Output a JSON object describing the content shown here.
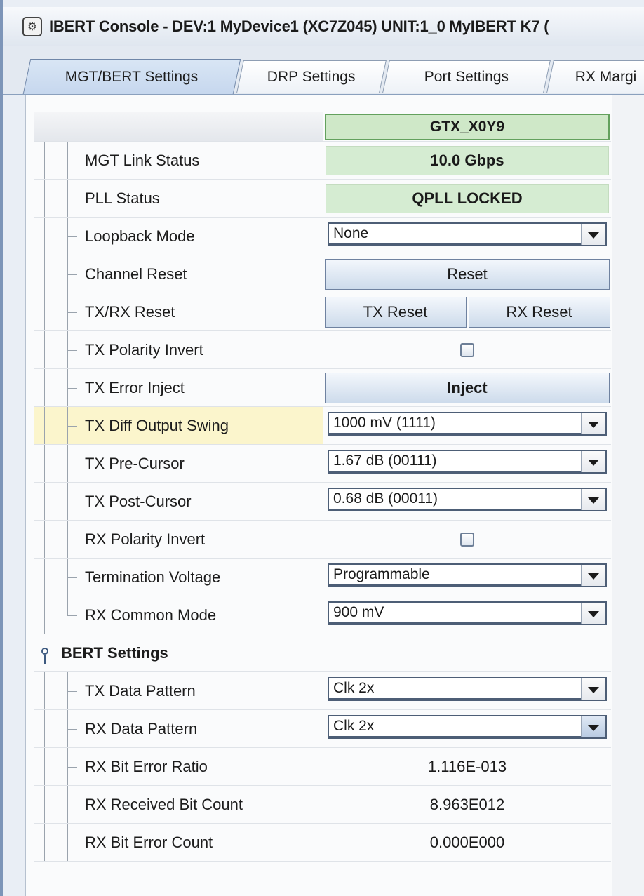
{
  "window": {
    "title": "IBERT Console - DEV:1 MyDevice1 (XC7Z045) UNIT:1_0 MyIBERT K7 (",
    "icon": "ibert-app-icon"
  },
  "tabs": [
    {
      "label": "MGT/BERT Settings",
      "active": true
    },
    {
      "label": "DRP Settings",
      "active": false
    },
    {
      "label": "Port Settings",
      "active": false
    },
    {
      "label": "RX Margi",
      "active": false
    }
  ],
  "grid": {
    "column_header": "GTX_X0Y9",
    "rows": {
      "mgt_link_status": {
        "label": "MGT Link Status",
        "value": "10.0 Gbps"
      },
      "pll_status": {
        "label": "PLL Status",
        "value": "QPLL LOCKED"
      },
      "loopback_mode": {
        "label": "Loopback Mode",
        "value": "None"
      },
      "channel_reset": {
        "label": "Channel Reset",
        "button": "Reset"
      },
      "txrx_reset": {
        "label": "TX/RX Reset",
        "tx_button": "TX Reset",
        "rx_button": "RX Reset"
      },
      "tx_polarity_invert": {
        "label": "TX Polarity Invert",
        "checked": false
      },
      "tx_error_inject": {
        "label": "TX Error Inject",
        "button": "Inject"
      },
      "tx_diff_output_swing": {
        "label": "TX Diff Output Swing",
        "value": "1000 mV (1111)"
      },
      "tx_pre_cursor": {
        "label": "TX Pre-Cursor",
        "value": "1.67 dB (00111)"
      },
      "tx_post_cursor": {
        "label": "TX Post-Cursor",
        "value": "0.68 dB (00011)"
      },
      "rx_polarity_invert": {
        "label": "RX Polarity Invert",
        "checked": false
      },
      "termination_voltage": {
        "label": "Termination Voltage",
        "value": "Programmable"
      },
      "rx_common_mode": {
        "label": "RX Common Mode",
        "value": "900 mV"
      },
      "bert_settings": {
        "label": "BERT Settings"
      },
      "tx_data_pattern": {
        "label": "TX Data Pattern",
        "value": "Clk 2x"
      },
      "rx_data_pattern": {
        "label": "RX Data Pattern",
        "value": "Clk 2x"
      },
      "rx_bit_error_ratio": {
        "label": "RX Bit Error Ratio",
        "value": "1.116E-013"
      },
      "rx_received_bit_count": {
        "label": "RX Received Bit Count",
        "value": "8.963E012"
      },
      "rx_bit_error_count": {
        "label": "RX Bit Error Count",
        "value": "0.000E000"
      }
    }
  },
  "colors": {
    "status_green": "#d5ecd2",
    "header_green_border": "#63a15d",
    "highlight_yellow": "#fbf5cc"
  }
}
